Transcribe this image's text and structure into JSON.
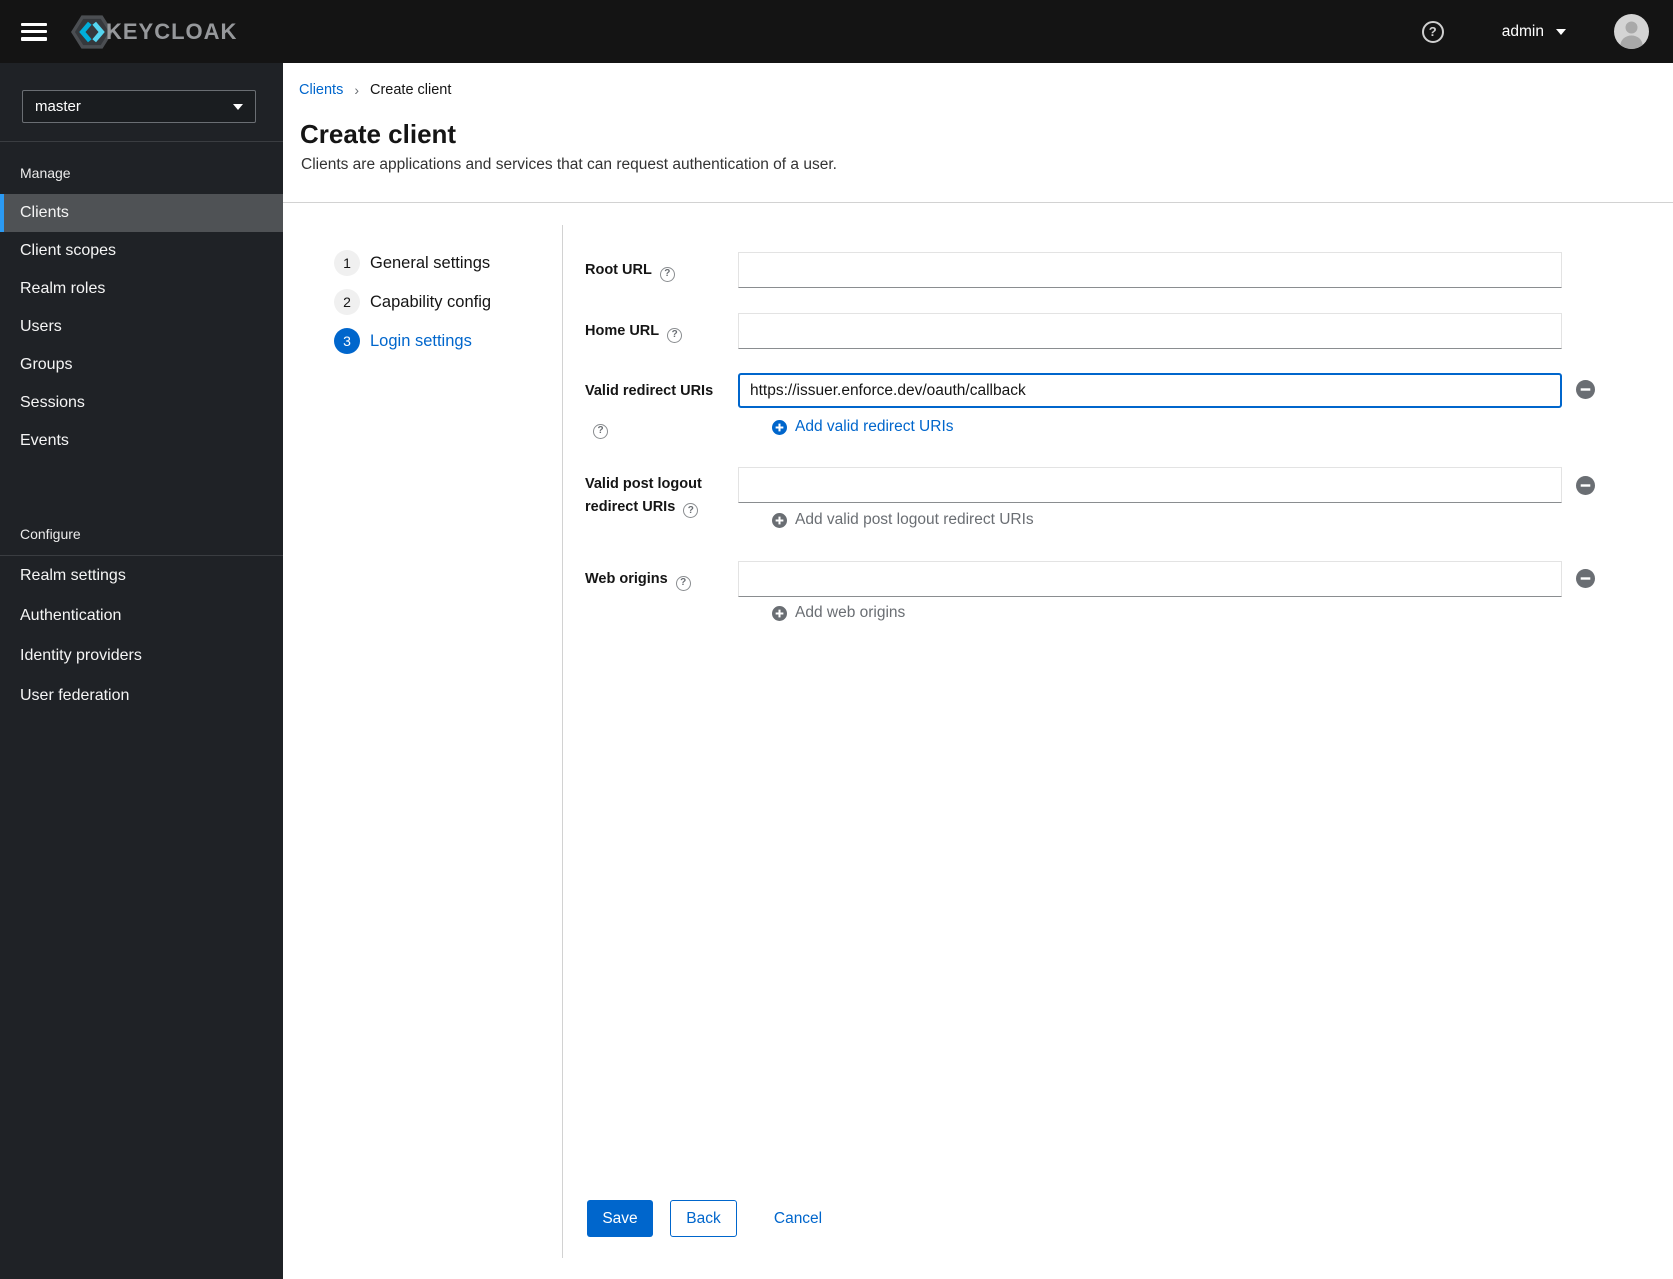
{
  "header": {
    "brand": "KEYCLOAK",
    "username": "admin"
  },
  "sidebar": {
    "realm": "master",
    "manage_title": "Manage",
    "manage_items": [
      "Clients",
      "Client scopes",
      "Realm roles",
      "Users",
      "Groups",
      "Sessions",
      "Events"
    ],
    "selected_item": "Clients",
    "configure_title": "Configure",
    "configure_items": [
      "Realm settings",
      "Authentication",
      "Identity providers",
      "User federation"
    ]
  },
  "breadcrumb": {
    "parent": "Clients",
    "separator": "›",
    "current": "Create client"
  },
  "page": {
    "title": "Create client",
    "subtitle": "Clients are applications and services that can request authentication of a user."
  },
  "wizard": {
    "active_step": "3",
    "steps": [
      {
        "number": "1",
        "label": "General settings"
      },
      {
        "number": "2",
        "label": "Capability config"
      },
      {
        "number": "3",
        "label": "Login settings"
      }
    ]
  },
  "form": {
    "help_glyph": "?",
    "root_url": {
      "label": "Root URL",
      "value": ""
    },
    "home_url": {
      "label": "Home URL",
      "value": ""
    },
    "valid_redirect_uris": {
      "label": "Valid redirect URIs",
      "value": "https://issuer.enforce.dev/oauth/callback",
      "add_label": "Add valid redirect URIs"
    },
    "post_logout_uris": {
      "label": "Valid post logout redirect URIs",
      "value": "",
      "add_label": "Add valid post logout redirect URIs"
    },
    "web_origins": {
      "label": "Web origins",
      "value": "",
      "add_label": "Add web origins"
    }
  },
  "actions": {
    "save": "Save",
    "back": "Back",
    "cancel": "Cancel"
  },
  "colors": {
    "accent": "#0066cc",
    "header_bg": "#141414",
    "sidebar_bg": "#1f2226",
    "selected_item_bg": "#4f5255",
    "selected_item_accent": "#2b9af3",
    "disabled_link": "#6a6e73",
    "logo_cyan": "#00b9e4"
  }
}
